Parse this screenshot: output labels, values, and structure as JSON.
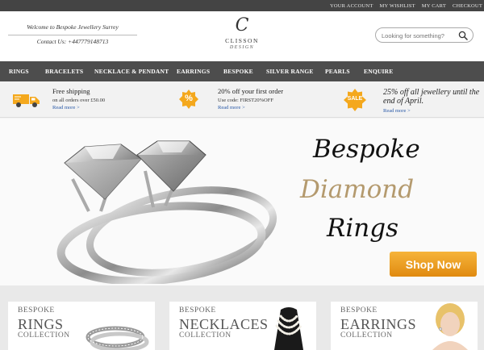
{
  "topbar": {
    "links": [
      "YOUR ACCOUNT",
      "MY WISHLIST",
      "MY CART",
      "CHECKOUT"
    ]
  },
  "header": {
    "welcome": "Welcome to Bespoke Jewellery Surrey",
    "contact": "Contact Us: +447779148713",
    "logo_mark": "C",
    "logo_name": "CLISSON",
    "logo_sub": "DESIGN",
    "search_placeholder": "Looking for something?"
  },
  "nav": {
    "items": [
      "RINGS",
      "BRACELETS",
      "NECKLACE & PENDANT",
      "EARRINGS",
      "BESPOKE",
      "SILVER RANGE",
      "PEARLS",
      "ENQUIRE"
    ]
  },
  "promo": {
    "shipping_title": "Free shipping",
    "shipping_sub": "on all orders over £50.00",
    "shipping_link": "Read more >",
    "discount_title": "20% off your first order",
    "discount_sub": "Use code: FIRST20%OFF",
    "discount_link": "Read more >",
    "discount_badge": "%",
    "sale_badge": "SALE",
    "sale_text": "25% off all jewellery until the end of April.",
    "sale_link": "Read more >"
  },
  "hero": {
    "line1": "Bespoke",
    "line2": "Diamond",
    "line3": "Rings",
    "cta": "Shop Now"
  },
  "cards": [
    {
      "l1": "BESPOKE",
      "l2": "RINGS",
      "l3": "COLLECTION"
    },
    {
      "l1": "BESPOKE",
      "l2": "NECKLACES",
      "l3": "COLLECTION"
    },
    {
      "l1": "BESPOKE",
      "l2": "EARRINGS",
      "l3": "COLLECTION"
    }
  ],
  "colors": {
    "topbar": "#444444",
    "nav": "#4d4d4d",
    "accent_orange": "#f4a81d",
    "gold_text": "#b49a6e",
    "link_blue": "#2a5aa8"
  }
}
